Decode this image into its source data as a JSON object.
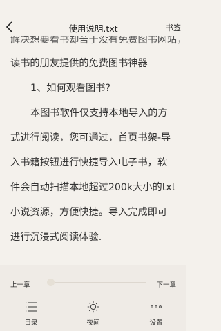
{
  "header": {
    "title": "使用说明.txt",
    "bookmark_label": "书签",
    "back_icon": "chevron-left-icon"
  },
  "reader": {
    "lines": [
      "解决想要看书却苦于没有免费图书网站，本软件是专门为想要",
      "读书的朋友提供的免费图书神器",
      "1、如何观看图书?",
      "本图书软件仅支持本地导入的方",
      "式进行阅读，您可通过，首页书架-导",
      "入书籍按钮进行快捷导入电子书，软",
      "件会自动扫描本地超过200k大小的txt",
      "小说资源，方便快捷。导入完成即可",
      "进行沉浸式阅读体验."
    ]
  },
  "chapter_bar": {
    "prev_label": "上一章",
    "next_label": "下一章",
    "progress": 0.0
  },
  "toolbar": {
    "items": [
      {
        "label": "目录",
        "icon": "menu-list-icon"
      },
      {
        "label": "夜间",
        "icon": "sun-icon"
      },
      {
        "label": "设置",
        "icon": "more-dots-icon"
      }
    ]
  },
  "colors": {
    "page_background": "#f4f1ec",
    "panel_background": "#efebe6",
    "text": "#2e2e2e"
  }
}
